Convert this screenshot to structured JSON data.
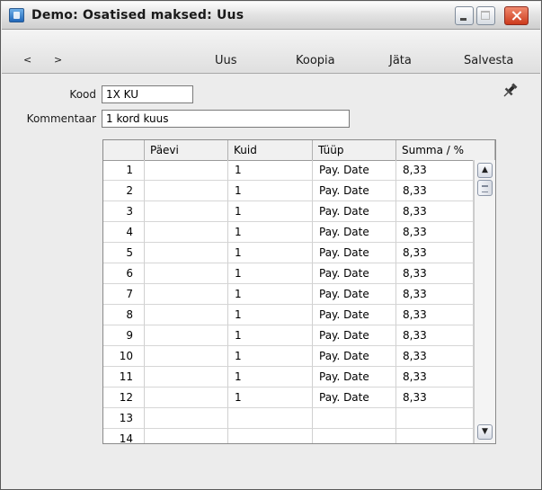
{
  "window": {
    "title": "Demo: Osatised maksed: Uus"
  },
  "toolbar": {
    "prev_label": "<",
    "next_label": ">",
    "uus_label": "Uus",
    "koopia_label": "Koopia",
    "jata_label": "Jäta",
    "salvesta_label": "Salvesta"
  },
  "form": {
    "kood_label": "Kood",
    "kood_value": "1X KU",
    "kommentaar_label": "Kommentaar",
    "kommentaar_value": "1 kord kuus"
  },
  "grid": {
    "columns": [
      "",
      "Päevi",
      "Kuid",
      "Tüüp",
      "Summa / %"
    ],
    "rows": [
      {
        "num": "1",
        "paevi": "",
        "kuid": "1",
        "tyyp": "Pay. Date",
        "summa": "8,33"
      },
      {
        "num": "2",
        "paevi": "",
        "kuid": "1",
        "tyyp": "Pay. Date",
        "summa": "8,33"
      },
      {
        "num": "3",
        "paevi": "",
        "kuid": "1",
        "tyyp": "Pay. Date",
        "summa": "8,33"
      },
      {
        "num": "4",
        "paevi": "",
        "kuid": "1",
        "tyyp": "Pay. Date",
        "summa": "8,33"
      },
      {
        "num": "5",
        "paevi": "",
        "kuid": "1",
        "tyyp": "Pay. Date",
        "summa": "8,33"
      },
      {
        "num": "6",
        "paevi": "",
        "kuid": "1",
        "tyyp": "Pay. Date",
        "summa": "8,33"
      },
      {
        "num": "7",
        "paevi": "",
        "kuid": "1",
        "tyyp": "Pay. Date",
        "summa": "8,33"
      },
      {
        "num": "8",
        "paevi": "",
        "kuid": "1",
        "tyyp": "Pay. Date",
        "summa": "8,33"
      },
      {
        "num": "9",
        "paevi": "",
        "kuid": "1",
        "tyyp": "Pay. Date",
        "summa": "8,33"
      },
      {
        "num": "10",
        "paevi": "",
        "kuid": "1",
        "tyyp": "Pay. Date",
        "summa": "8,33"
      },
      {
        "num": "11",
        "paevi": "",
        "kuid": "1",
        "tyyp": "Pay. Date",
        "summa": "8,33"
      },
      {
        "num": "12",
        "paevi": "",
        "kuid": "1",
        "tyyp": "Pay. Date",
        "summa": "8,33"
      },
      {
        "num": "13",
        "paevi": "",
        "kuid": "",
        "tyyp": "",
        "summa": ""
      },
      {
        "num": "14",
        "paevi": "",
        "kuid": "",
        "tyyp": "",
        "summa": ""
      }
    ]
  },
  "icons": {
    "app": "app-icon",
    "pin": "pin-icon",
    "minimize": "minimize-icon",
    "maximize": "maximize-icon",
    "close": "close-icon",
    "scroll_up": "chevron-up-icon",
    "scroll_down": "chevron-down-icon"
  },
  "colors": {
    "close_button": "#cc3a1c",
    "window_bg": "#ececec"
  }
}
